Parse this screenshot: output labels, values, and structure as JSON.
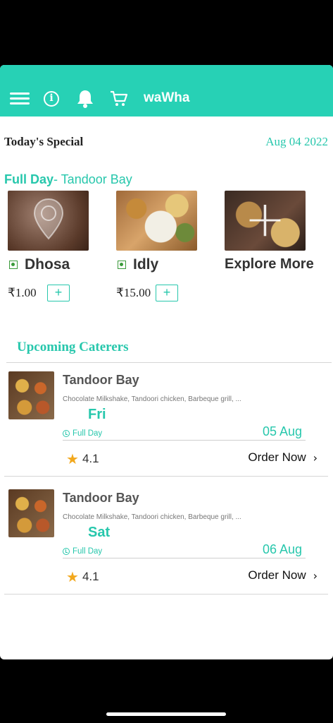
{
  "header": {
    "brand": "waWha",
    "icons": [
      "menu-icon",
      "info-icon",
      "bell-icon",
      "cart-icon"
    ],
    "color": "#27d1b5"
  },
  "todays_special": {
    "title": "Today's Special",
    "date": "Aug 04 2022",
    "meal_label": "Full Day",
    "caterer": "- Tandoor Bay",
    "items": [
      {
        "name": "Dhosa",
        "price": "₹1.00",
        "add": "+",
        "veg": true
      },
      {
        "name": "Idly",
        "price": "₹15.00",
        "add": "+",
        "veg": true
      },
      {
        "name": "Explore More"
      }
    ]
  },
  "upcoming": {
    "title": "Upcoming Caterers",
    "caterers": [
      {
        "name": "Tandoor Bay",
        "menu": "Chocolate Milkshake, Tandoori chicken, Barbeque grill, ...",
        "day": "Fri",
        "meal": "Full Day",
        "date": "05 Aug",
        "rating": "4.1",
        "cta": "Order Now"
      },
      {
        "name": "Tandoor Bay",
        "menu": "Chocolate Milkshake, Tandoori chicken, Barbeque grill, ...",
        "day": "Sat",
        "meal": "Full Day",
        "date": "06 Aug",
        "rating": "4.1",
        "cta": "Order Now"
      }
    ]
  },
  "colors": {
    "accent": "#27c7ac",
    "star": "#f2a81d"
  }
}
